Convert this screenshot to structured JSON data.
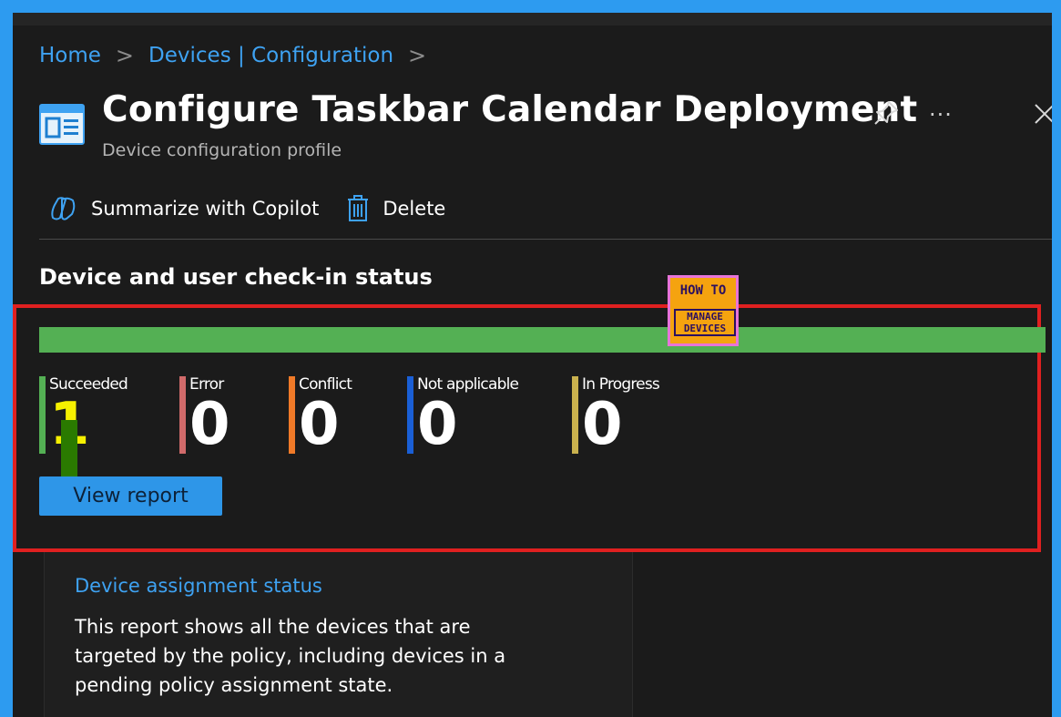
{
  "breadcrumb": {
    "home": "Home",
    "section": "Devices | Configuration",
    "separator": ">"
  },
  "header": {
    "title": "Configure Taskbar Calendar Deployment",
    "subtitle": "Device configuration profile",
    "more_label": "···"
  },
  "toolbar": {
    "copilot_label": "Summarize with Copilot",
    "delete_label": "Delete"
  },
  "checkin": {
    "title": "Device and user check-in status",
    "progress_fraction_succeeded": 1.0,
    "stats": [
      {
        "label": "Succeeded",
        "value": "1",
        "color": "#54b054"
      },
      {
        "label": "Error",
        "value": "0",
        "color": "#d06a6a"
      },
      {
        "label": "Conflict",
        "value": "0",
        "color": "#f07a28"
      },
      {
        "label": "Not applicable",
        "value": "0",
        "color": "#1a5fd6"
      },
      {
        "label": "In Progress",
        "value": "0",
        "color": "#c9b14e"
      }
    ],
    "view_report_label": "View report"
  },
  "logo": {
    "line1": "HOW TO",
    "line2a": "MANAGE",
    "line2b": "DEVICES"
  },
  "assignment_card": {
    "link": "Device assignment status",
    "description": "This report shows all the devices that are targeted by the policy, including devices in a pending policy assignment state."
  },
  "colors": {
    "accent": "#3ea2f2",
    "highlight_box": "#e02020",
    "background": "#1b1b1b"
  }
}
